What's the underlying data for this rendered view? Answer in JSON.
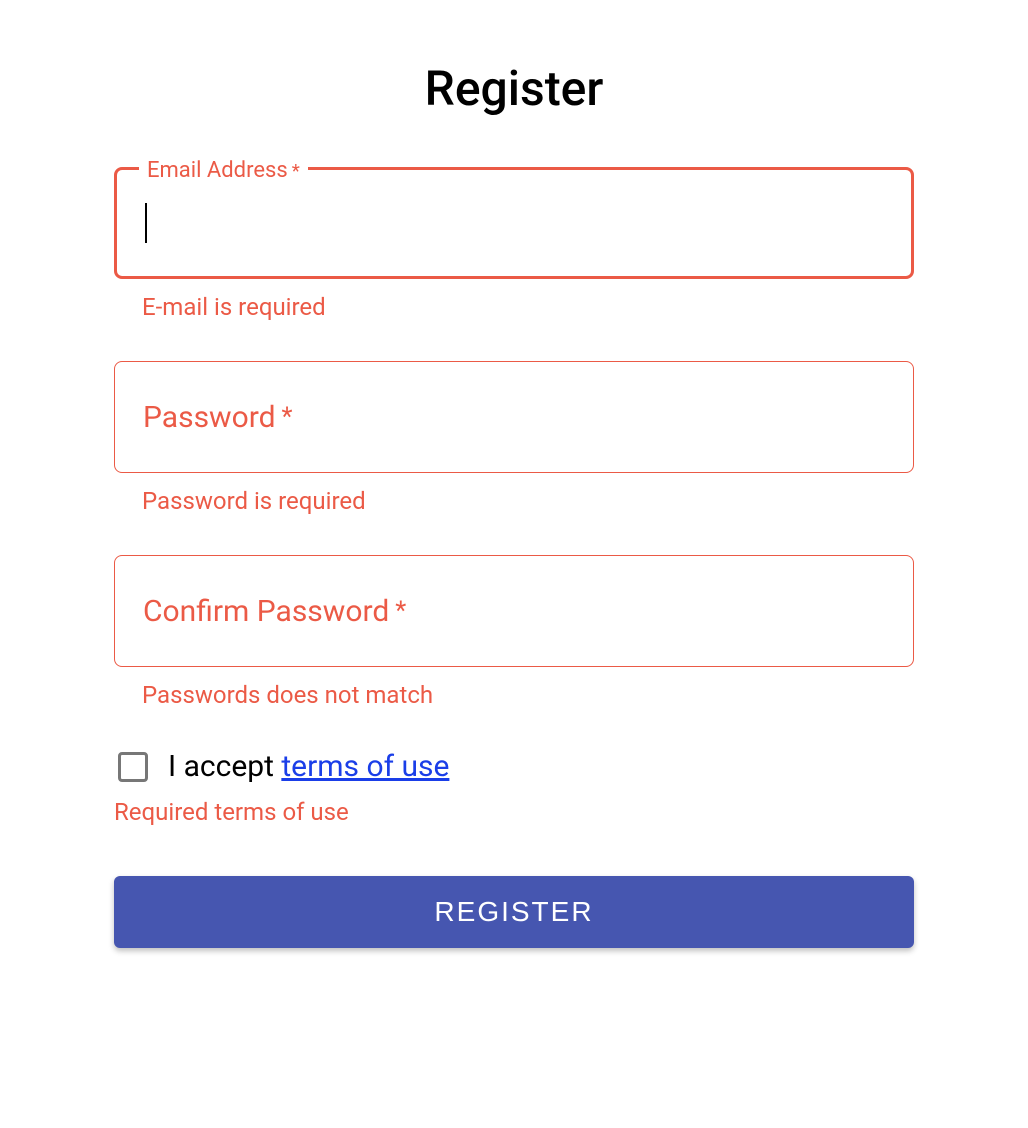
{
  "title": "Register",
  "fields": {
    "email": {
      "label": "Email Address",
      "required_mark": "*",
      "value": "",
      "error": "E-mail is required"
    },
    "password": {
      "label": "Password",
      "required_mark": "*",
      "value": "",
      "error": "Password is required"
    },
    "confirm_password": {
      "label": "Confirm Password",
      "required_mark": "*",
      "value": "",
      "error": "Passwords does not match"
    }
  },
  "terms": {
    "prefix": "I accept ",
    "link_text": "terms of use",
    "checked": false,
    "error": "Required terms of use"
  },
  "submit": {
    "label": "REGISTER"
  },
  "colors": {
    "error": "#eb5a46",
    "primary": "#4656b0",
    "link": "#1a3ee8"
  }
}
